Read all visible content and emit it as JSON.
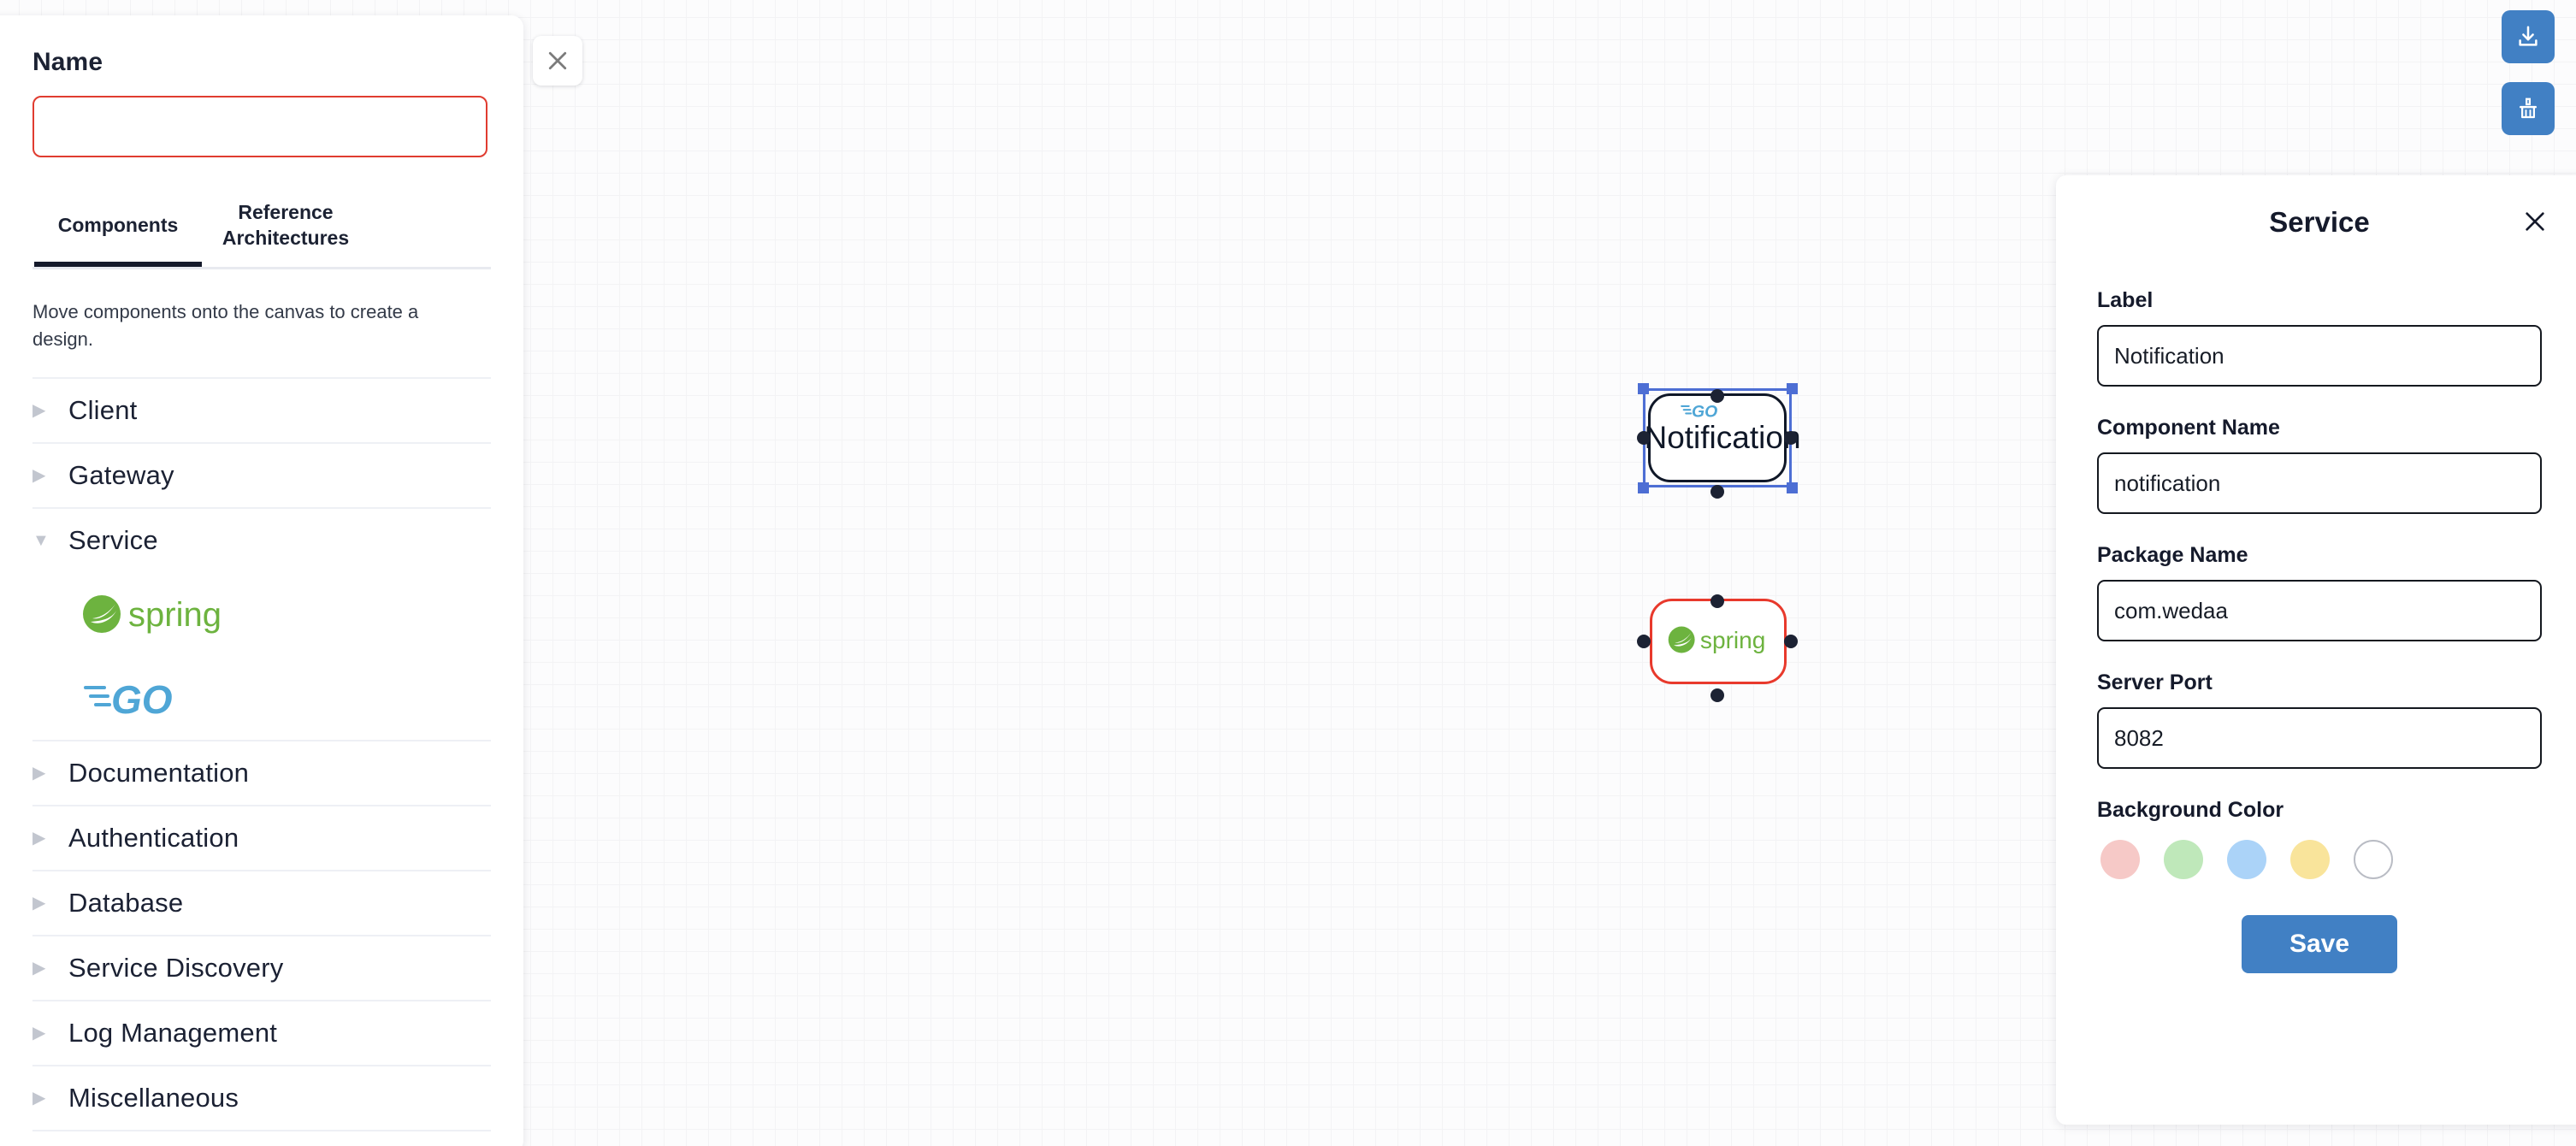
{
  "sidebar": {
    "name_label": "Name",
    "name_value": "",
    "name_placeholder": "",
    "tabs": [
      {
        "label": "Components",
        "active": true
      },
      {
        "label": "Reference\nArchitectures",
        "active": false
      }
    ],
    "tab1_label": "Components",
    "tab2_line1": "Reference",
    "tab2_line2": "Architectures",
    "hint": "Move components onto the canvas to create a design.",
    "categories": [
      {
        "label": "Client",
        "expanded": false
      },
      {
        "label": "Gateway",
        "expanded": false
      },
      {
        "label": "Service",
        "expanded": true
      },
      {
        "label": "Documentation",
        "expanded": false
      },
      {
        "label": "Authentication",
        "expanded": false
      },
      {
        "label": "Database",
        "expanded": false
      },
      {
        "label": "Service Discovery",
        "expanded": false
      },
      {
        "label": "Log Management",
        "expanded": false
      },
      {
        "label": "Miscellaneous",
        "expanded": false
      }
    ],
    "service_items": [
      {
        "name": "spring",
        "icon": "spring-logo-icon"
      },
      {
        "name": "GO",
        "icon": "go-logo-icon"
      }
    ],
    "caret_collapsed": "▶",
    "caret_expanded": "▼"
  },
  "canvas": {
    "close_icon": "close-icon",
    "toolbar": [
      {
        "name": "download-button",
        "icon": "download-icon"
      },
      {
        "name": "clear-canvas-button",
        "icon": "broom-icon"
      }
    ],
    "nodes": [
      {
        "id": "notification",
        "label": "Notification",
        "icon": "go-logo-icon",
        "border_color": "#101828",
        "selected": true
      },
      {
        "id": "spring-service",
        "label": "",
        "icon": "spring-logo-icon",
        "border_color": "#e8392c",
        "selected": false
      }
    ]
  },
  "properties": {
    "title": "Service",
    "close_icon": "close-icon",
    "fields": [
      {
        "label": "Label",
        "value": "Notification",
        "name": "label-field"
      },
      {
        "label": "Component Name",
        "value": "notification",
        "name": "component-name-field"
      },
      {
        "label": "Package Name",
        "value": "com.wedaa",
        "name": "package-name-field"
      },
      {
        "label": "Server Port",
        "value": "8082",
        "name": "server-port-field"
      }
    ],
    "background_color_label": "Background Color",
    "swatches": [
      {
        "color": "#f6c9c7",
        "name": "pink"
      },
      {
        "color": "#bfe8ba",
        "name": "green"
      },
      {
        "color": "#abd3f8",
        "name": "blue"
      },
      {
        "color": "#f9e49b",
        "name": "yellow"
      },
      {
        "color": "#ffffff",
        "name": "white"
      }
    ],
    "save_label": "Save",
    "accent_color": "#4180c4"
  }
}
